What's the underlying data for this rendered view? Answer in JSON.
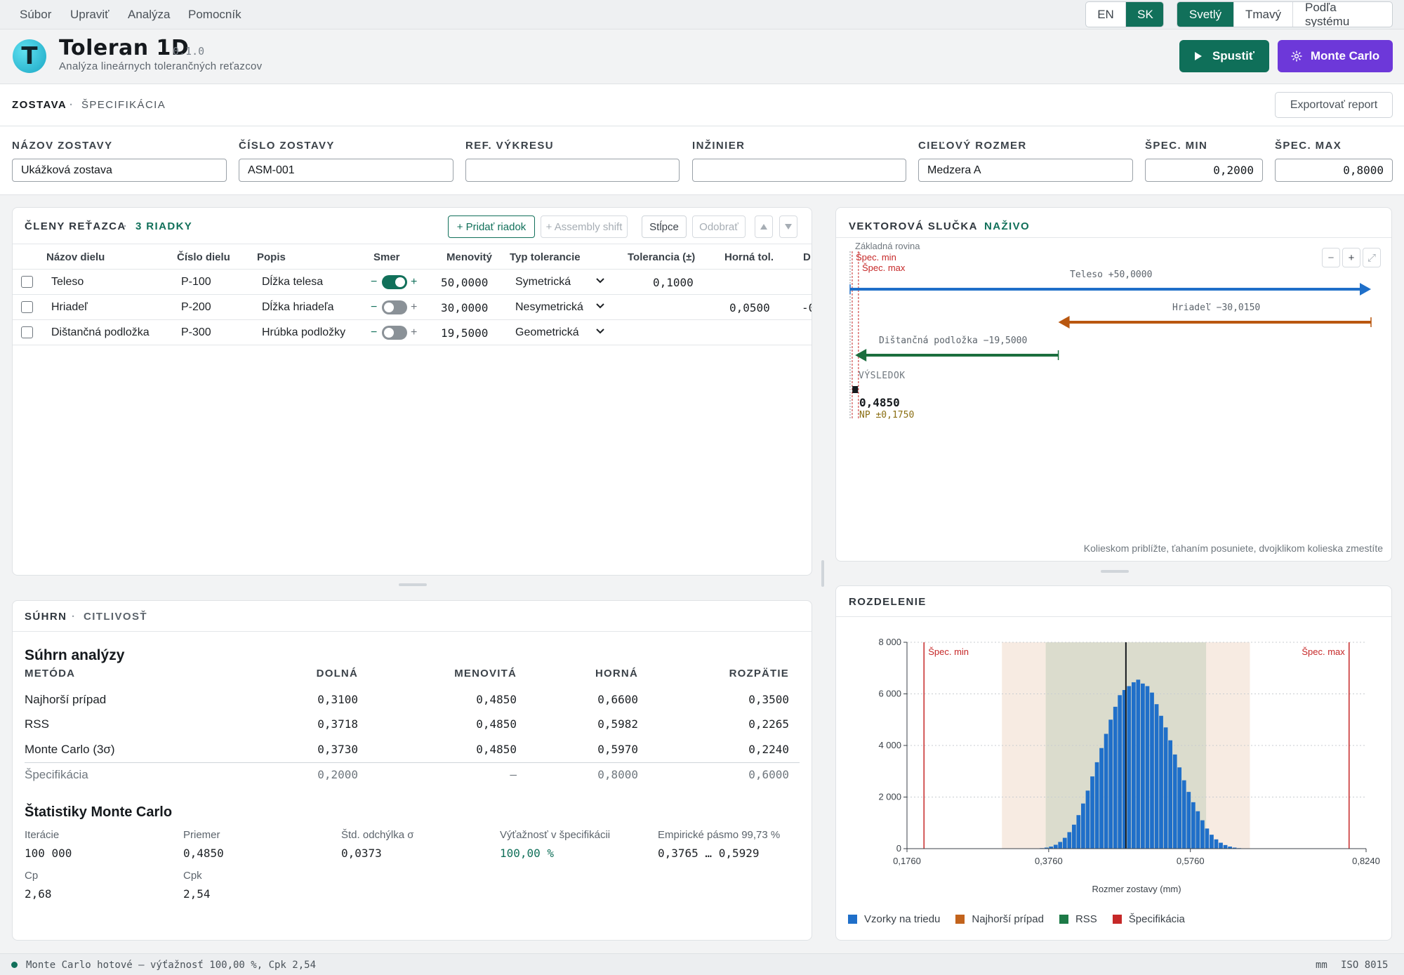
{
  "menu": [
    "Súbor",
    "Upraviť",
    "Analýza",
    "Pomocník"
  ],
  "language": {
    "options": [
      "EN",
      "SK"
    ],
    "active": "SK"
  },
  "theme": {
    "options": [
      "Svetlý",
      "Tmavý",
      "Podľa systému"
    ],
    "active": "Svetlý"
  },
  "app": {
    "title": "Toleran 1D",
    "version": "0.1.0",
    "subtitle": "Analýza lineárnych tolerančných reťazcov",
    "logo_letter": "T"
  },
  "actions": {
    "run_label": "Spustiť",
    "mc_label": "Monte Carlo",
    "export_label": "Exportovať report"
  },
  "tabs": {
    "assembly": "ZOSTAVA",
    "spec": "ŠPECIFIKÁCIA",
    "sep": "·"
  },
  "form": [
    {
      "label": "NÁZOV ZOSTAVY",
      "value": ""
    },
    {
      "label": "ČÍSLO ZOSTAVY",
      "value": ""
    },
    {
      "label": "REF. VÝKRESU",
      "value": ""
    },
    {
      "label": "INŽINIER",
      "value": ""
    },
    {
      "label": "CIEĽOVÝ ROZMER",
      "value": "Medzera A"
    },
    {
      "label": "ŠPEC. MIN",
      "value": "0,2000"
    },
    {
      "label": "ŠPEC. MAX",
      "value": "0,8000"
    }
  ],
  "form_values": {
    "name": "Ukážková zostava",
    "number": "ASM-001"
  },
  "members": {
    "title": "ČLENY REŤAZCA",
    "count": "3 RIADKY",
    "toolbar": {
      "add": "+ Pridať riadok",
      "shift": "+ Assembly shift",
      "columns": "Stĺpce",
      "remove": "Odobrať"
    },
    "columns": [
      "Názov dielu",
      "Číslo dielu",
      "Popis",
      "Smer",
      "Menovitý",
      "Typ tolerancie",
      "Tolerancia (±)",
      "Horná tol.",
      "D"
    ],
    "rows": [
      {
        "name": "Teleso",
        "part": "P-100",
        "desc": "Dĺžka telesa",
        "dir_on": true,
        "nominal": "50,0000",
        "type": "Symetrická",
        "tol": "0,1000",
        "upper": "",
        "lower": ""
      },
      {
        "name": "Hriadeľ",
        "part": "P-200",
        "desc": "Dĺžka hriadeľa",
        "dir_on": false,
        "nominal": "30,0000",
        "type": "Nesymetrická",
        "tol": "",
        "upper": "0,0500",
        "lower": "-0"
      },
      {
        "name": "Dištančná podložka",
        "part": "P-300",
        "desc": "Hrúbka podložky",
        "dir_on": false,
        "nominal": "19,5000",
        "type": "Geometrická",
        "tol": "",
        "upper": "",
        "lower": ""
      }
    ],
    "minus": "−",
    "plus": "+"
  },
  "vector": {
    "title": "VEKTOROVÁ SLUČKA",
    "live": "NAŽIVO",
    "base_label": "Základná rovina",
    "spec_min": "Špec. min",
    "spec_max": "Špec. max",
    "vectors": [
      {
        "label": "Teleso +50,0000",
        "color": "#1f6fc9",
        "from": 0,
        "to": 50
      },
      {
        "label": "Hriadeľ −30,0150",
        "color": "#b9570f",
        "from": 50,
        "to": 19.985
      },
      {
        "label": "Dištančná podložka −19,5000",
        "color": "#1b6e3e",
        "from": 19.985,
        "to": 0.485
      }
    ],
    "result_label": "VÝSLEDOK",
    "result_value": "0,4850",
    "result_tol": "NP ±0,1750",
    "hint": "Kolieskom priblížte, ťahaním posuniete, dvojklikom kolieska zmestíte",
    "zoom": {
      "minus": "−",
      "plus": "+",
      "fit": "⤢"
    }
  },
  "summary": {
    "tabs": {
      "summary": "SÚHRN",
      "sensitivity": "CITLIVOSŤ"
    },
    "title": "Súhrn analýzy",
    "columns": [
      "METÓDA",
      "DOLNÁ",
      "MENOVITÁ",
      "HORNÁ",
      "ROZPÄTIE"
    ],
    "rows": [
      {
        "method": "Najhorší prípad",
        "lower": "0,3100",
        "nominal": "0,4850",
        "upper": "0,6600",
        "range": "0,3500"
      },
      {
        "method": "RSS",
        "lower": "0,3718",
        "nominal": "0,4850",
        "upper": "0,5982",
        "range": "0,2265"
      },
      {
        "method": "Monte Carlo (3σ)",
        "lower": "0,3730",
        "nominal": "0,4850",
        "upper": "0,5970",
        "range": "0,2240"
      },
      {
        "method": "Špecifikácia",
        "lower": "0,2000",
        "nominal": "—",
        "upper": "0,8000",
        "range": "0,6000"
      }
    ],
    "mc_title": "Štatistiky Monte Carlo",
    "stats": [
      {
        "label": "Iterácie",
        "value": "100 000"
      },
      {
        "label": "Priemer",
        "value": "0,4850"
      },
      {
        "label": "Štd. odchýlka σ",
        "value": "0,0373"
      },
      {
        "label": "Výťažnosť v špecifikácii",
        "value": "100,00 %"
      },
      {
        "label": "Empirické pásmo 99,73 %",
        "value": "0,3765 … 0,5929"
      },
      {
        "label": "Cp",
        "value": "2,68"
      },
      {
        "label": "Cpk",
        "value": "2,54"
      }
    ]
  },
  "distribution": {
    "title": "ROZDELENIE",
    "legend": [
      {
        "label": "Vzorky na triedu",
        "color": "#1f6fc9"
      },
      {
        "label": "Najhorší prípad",
        "color": "#c2631c"
      },
      {
        "label": "RSS",
        "color": "#1d7a47"
      },
      {
        "label": "Špecifikácia",
        "color": "#c62828"
      }
    ]
  },
  "chart_data": {
    "type": "bar",
    "xlabel": "Rozmer zostavy (mm)",
    "ylabel": "",
    "xlim": [
      0.176,
      0.824
    ],
    "ylim": [
      0,
      8000
    ],
    "x_ticks": [
      "0,1760",
      "0,3760",
      "0,5760",
      "0,8240"
    ],
    "x_tick_values": [
      0.176,
      0.376,
      0.576,
      0.824
    ],
    "y_ticks": [
      "0",
      "2 000",
      "4 000",
      "6 000",
      "8 000"
    ],
    "y_tick_values": [
      0,
      2000,
      4000,
      6000,
      8000
    ],
    "spec_lines": [
      {
        "label": "Špec. min",
        "x": 0.2
      },
      {
        "label": "Špec. max",
        "x": 0.8
      }
    ],
    "worst_case_band": [
      0.31,
      0.66
    ],
    "rss_band": [
      0.3718,
      0.5982
    ],
    "nominal": 0.485,
    "bin_width": 0.00648,
    "bins_x": [
      0.3667,
      0.3732,
      0.3797,
      0.3862,
      0.3926,
      0.3991,
      0.4056,
      0.4121,
      0.4185,
      0.425,
      0.4315,
      0.438,
      0.4445,
      0.4509,
      0.4574,
      0.4639,
      0.4704,
      0.4768,
      0.4833,
      0.4898,
      0.4963,
      0.5027,
      0.5092,
      0.5157,
      0.5222,
      0.5287,
      0.5351,
      0.5416,
      0.5481,
      0.5546,
      0.561,
      0.5675,
      0.574,
      0.5805,
      0.5869,
      0.5934
    ],
    "values": [
      20,
      40,
      80,
      150,
      260,
      420,
      640,
      930,
      1300,
      1750,
      2250,
      2800,
      3350,
      3900,
      4450,
      5000,
      5500,
      5950,
      6150,
      6300,
      6450,
      6550,
      6400,
      6300,
      6050,
      5600,
      5150,
      4700,
      4200,
      3650,
      3150,
      2650,
      2200,
      1800,
      1450,
      1100
    ],
    "tail_values": [
      780,
      540,
      360,
      230,
      140,
      80,
      40,
      20
    ]
  },
  "statusbar": {
    "message": "Monte Carlo hotové — výťažnosť 100,00 %, Cpk 2,54",
    "units": "mm",
    "standard": "ISO 8015"
  }
}
